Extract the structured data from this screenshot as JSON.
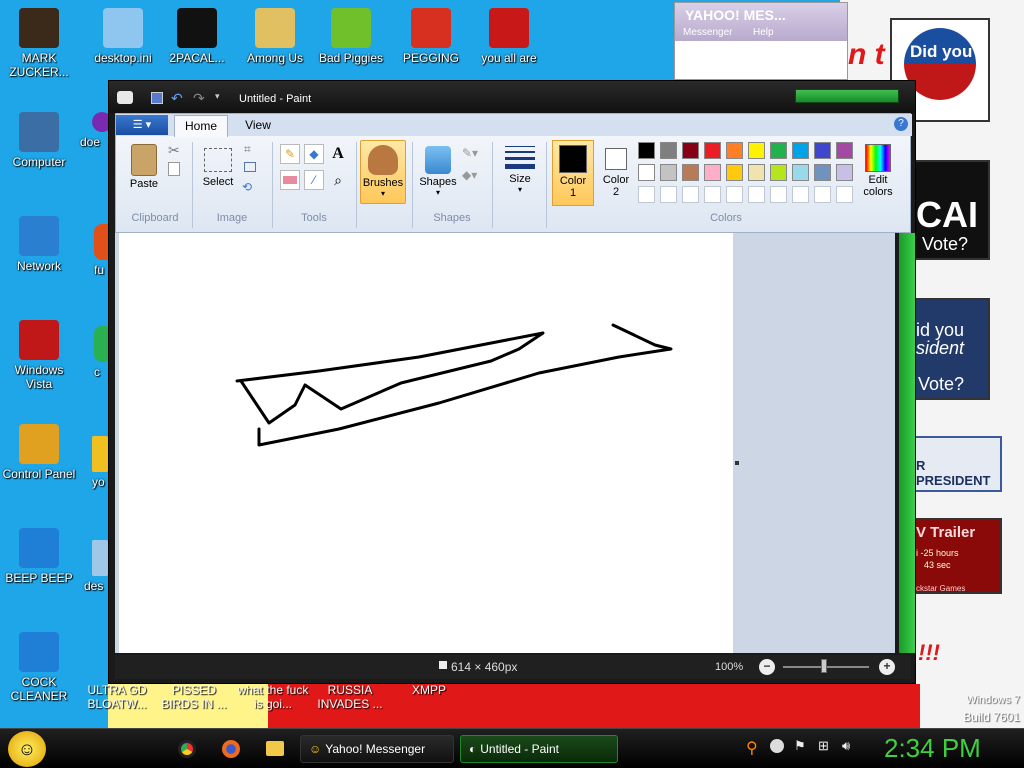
{
  "desktop": {
    "left_icons": [
      {
        "label": "MARK ZUCKER...",
        "icon": "person-icon",
        "color": "#3b2a1a"
      },
      {
        "label": "Computer",
        "icon": "computer-icon",
        "color": "#3a6ea5"
      },
      {
        "label": "Network",
        "icon": "network-icon",
        "color": "#2a7fd0"
      },
      {
        "label": "Windows Vista",
        "icon": "recycle-bin-icon",
        "color": "#c01818"
      },
      {
        "label": "Control Panel",
        "icon": "control-panel-icon",
        "color": "#e0a020"
      },
      {
        "label": "BEEP BEEP",
        "icon": "file-icon",
        "color": "#1f7fd6"
      },
      {
        "label": "COCK CLEANER",
        "icon": "file-icon",
        "color": "#1f7fd6"
      }
    ],
    "top_icons": [
      {
        "label": "desktop.ini",
        "icon": "config-file-icon",
        "color": "#8fc6ef"
      },
      {
        "label": "2PACAL...",
        "icon": "terminal-icon",
        "color": "#111111"
      },
      {
        "label": "Among Us",
        "icon": "among-us-icon",
        "color": "#e0c060"
      },
      {
        "label": "Bad Piggies",
        "icon": "bad-piggies-icon",
        "color": "#6fc02a"
      },
      {
        "label": "PEGGING",
        "icon": "p-logo-icon",
        "color": "#d83020"
      },
      {
        "label": "you all are",
        "icon": "dev-cpp-icon",
        "color": "#c81818"
      }
    ],
    "second_col_partial": [
      "doe",
      "fu",
      "c",
      "yo",
      "des"
    ],
    "bottom_labels": [
      "ULTRA GD BLOATW...",
      "PISSED BIRDS IN ...",
      "what the fuck is goi...",
      "RUSSIA INVADES ...",
      "XMPP"
    ],
    "watermark": {
      "line1": "Windows 7",
      "line2": "Build 7601"
    },
    "ads": {
      "did_you_1": "Did you",
      "did_you_2": "id you",
      "cal": "CAI",
      "vote": "Vote?",
      "vote2": "Vote?",
      "ident": "sident",
      "president": "R PRESIDENT",
      "trailer": "V Trailer",
      "trailer_sub1": "i -25 hours",
      "trailer_sub2": "43 sec",
      "trailer_sub3": "ckstar Games",
      "red_text": "n t",
      "exclaim": "!!!"
    }
  },
  "yahoo_window": {
    "title": "YAHOO! MES...",
    "menu": [
      "Messenger",
      "Help"
    ]
  },
  "paint": {
    "title": "Untitled - Paint",
    "tabs": [
      "Home",
      "View"
    ],
    "clipboard": {
      "paste": "Paste",
      "group": "Clipboard"
    },
    "image": {
      "select": "Select",
      "group": "Image"
    },
    "tools": {
      "group": "Tools"
    },
    "brushes": {
      "label": "Brushes"
    },
    "shapes": {
      "label": "Shapes",
      "group": "Shapes"
    },
    "size": {
      "label": "Size"
    },
    "color1": {
      "label": "Color",
      "num": "1",
      "value": "#000000"
    },
    "color2": {
      "label": "Color",
      "num": "2",
      "value": "#ffffff"
    },
    "colors_group": "Colors",
    "edit_colors": {
      "line1": "Edit",
      "line2": "colors"
    },
    "palette_row1": [
      "#000000",
      "#7f7f7f",
      "#880015",
      "#ed1c24",
      "#ff7f27",
      "#fff200",
      "#22b14c",
      "#00a2e8",
      "#3f48cc",
      "#a349a4"
    ],
    "palette_row2": [
      "#ffffff",
      "#c3c3c3",
      "#b97a57",
      "#ffaec9",
      "#ffc90e",
      "#efe4b0",
      "#b5e61d",
      "#99d9ea",
      "#7092be",
      "#c8bfe7"
    ],
    "status": {
      "size": "614 × 460px",
      "zoom": "100%"
    }
  },
  "taskbar": {
    "buttons": [
      "Yahoo! Messenger",
      "Untitled - Paint"
    ],
    "clock": "2:34 PM"
  }
}
